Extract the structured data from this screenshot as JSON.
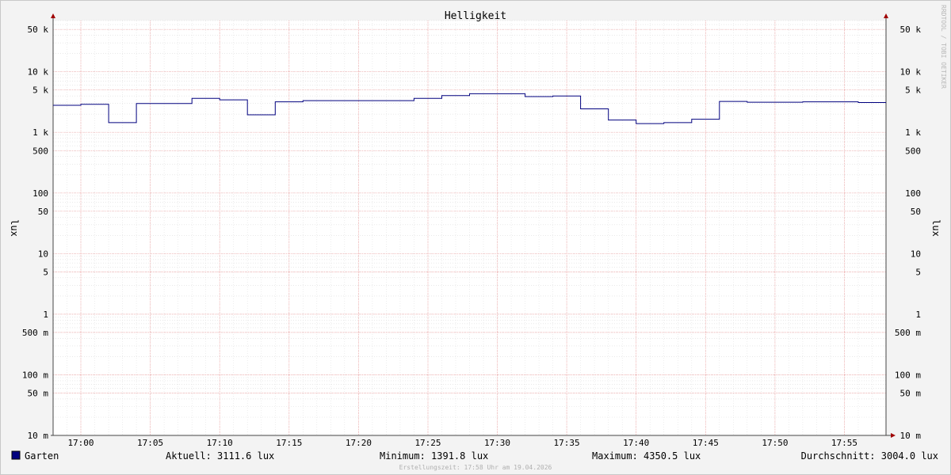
{
  "chart_data": {
    "type": "line",
    "title": "Helligkeit",
    "ylabel": "lux",
    "y_scale": "log",
    "ylim": [
      0.01,
      70000
    ],
    "xlim": [
      "16:58",
      "17:58"
    ],
    "grid": true,
    "watermark": "RRDTOOL / TOBI OETIKER",
    "y_ticks": [
      {
        "value": 50000,
        "label": "50 k"
      },
      {
        "value": 10000,
        "label": "10 k"
      },
      {
        "value": 5000,
        "label": "5 k"
      },
      {
        "value": 1000,
        "label": "1 k"
      },
      {
        "value": 500,
        "label": "500"
      },
      {
        "value": 100,
        "label": "100"
      },
      {
        "value": 50,
        "label": "50"
      },
      {
        "value": 10,
        "label": "10"
      },
      {
        "value": 5,
        "label": "5"
      },
      {
        "value": 1,
        "label": "1"
      },
      {
        "value": 0.5,
        "label": "500 m"
      },
      {
        "value": 0.1,
        "label": "100 m"
      },
      {
        "value": 0.05,
        "label": "50 m"
      },
      {
        "value": 0.01,
        "label": "10 m"
      }
    ],
    "x_ticks": [
      {
        "value": "17:00",
        "label": "17:00"
      },
      {
        "value": "17:05",
        "label": "17:05"
      },
      {
        "value": "17:10",
        "label": "17:10"
      },
      {
        "value": "17:15",
        "label": "17:15"
      },
      {
        "value": "17:20",
        "label": "17:20"
      },
      {
        "value": "17:25",
        "label": "17:25"
      },
      {
        "value": "17:30",
        "label": "17:30"
      },
      {
        "value": "17:35",
        "label": "17:35"
      },
      {
        "value": "17:40",
        "label": "17:40"
      },
      {
        "value": "17:45",
        "label": "17:45"
      },
      {
        "value": "17:50",
        "label": "17:50"
      },
      {
        "value": "17:55",
        "label": "17:55"
      }
    ],
    "series": [
      {
        "name": "Garten",
        "color": "#00007f",
        "steps": [
          {
            "t": "16:58",
            "v": 2800
          },
          {
            "t": "17:00",
            "v": 2900
          },
          {
            "t": "17:02",
            "v": 1450
          },
          {
            "t": "17:04",
            "v": 3000
          },
          {
            "t": "17:08",
            "v": 3650
          },
          {
            "t": "17:10",
            "v": 3450
          },
          {
            "t": "17:12",
            "v": 1950
          },
          {
            "t": "17:14",
            "v": 3200
          },
          {
            "t": "17:16",
            "v": 3350
          },
          {
            "t": "17:24",
            "v": 3650
          },
          {
            "t": "17:26",
            "v": 4050
          },
          {
            "t": "17:28",
            "v": 4350
          },
          {
            "t": "17:32",
            "v": 3900
          },
          {
            "t": "17:34",
            "v": 4000
          },
          {
            "t": "17:36",
            "v": 2450
          },
          {
            "t": "17:38",
            "v": 1600
          },
          {
            "t": "17:40",
            "v": 1400
          },
          {
            "t": "17:42",
            "v": 1450
          },
          {
            "t": "17:44",
            "v": 1650
          },
          {
            "t": "17:46",
            "v": 3250
          },
          {
            "t": "17:48",
            "v": 3150
          },
          {
            "t": "17:52",
            "v": 3200
          },
          {
            "t": "17:56",
            "v": 3111.6
          },
          {
            "t": "17:58",
            "v": 3111.6
          }
        ]
      }
    ]
  },
  "legend": {
    "series_name": "Garten",
    "color": "#00007f",
    "current": "Aktuell: 3111.6 lux",
    "minimum": "Minimum: 1391.8 lux",
    "maximum": "Maximum: 4350.5 lux",
    "average": "Durchschnitt: 3004.0 lux"
  },
  "footer": "Erstellungszeit: 17:58 Uhr am 19.04.2026"
}
